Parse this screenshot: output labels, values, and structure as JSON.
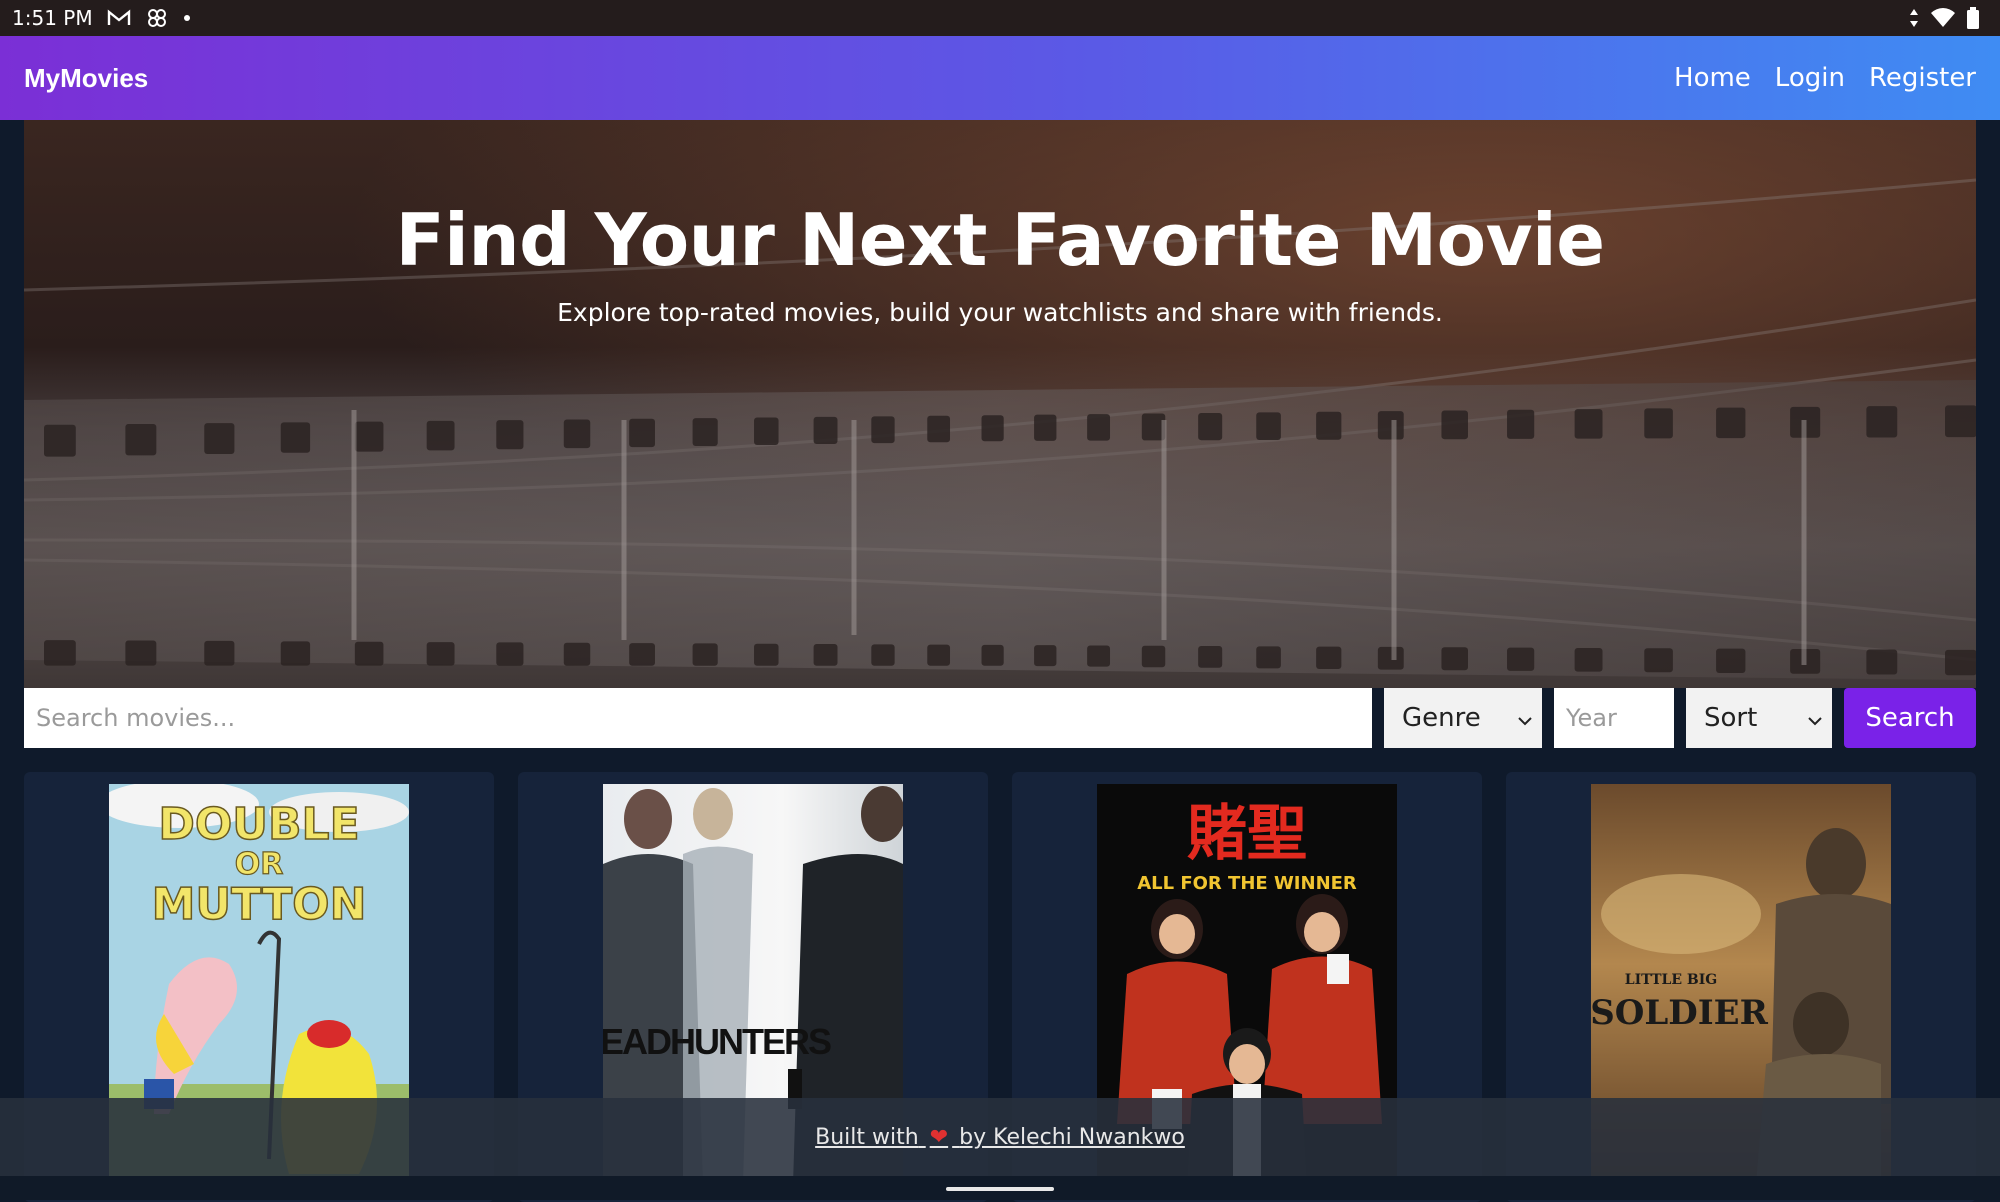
{
  "statusbar": {
    "time": "1:51 PM",
    "icons": [
      "gmail-icon",
      "pinwheel-icon",
      "dot-icon"
    ],
    "right_icons": [
      "data-icon",
      "wifi-icon",
      "battery-icon"
    ]
  },
  "navbar": {
    "brand": "MyMovies",
    "links": [
      "Home",
      "Login",
      "Register"
    ]
  },
  "hero": {
    "title": "Find Your Next Favorite Movie",
    "subtitle": "Explore top-rated movies, build your watchlists and share with friends."
  },
  "search": {
    "placeholder": "Search movies...",
    "genre": "Genre",
    "year_placeholder": "Year",
    "sort": "Sort",
    "button": "Search"
  },
  "movies": [
    {
      "title_art": [
        "DOUBLE",
        "OR",
        "MUTTON"
      ]
    },
    {
      "title_art": [
        "HEADHUNTERS"
      ]
    },
    {
      "title_art": [
        "賭聖",
        "ALL FOR THE WINNER"
      ]
    },
    {
      "title_art": [
        "LITTLE BIG",
        "SOLDIER"
      ]
    }
  ],
  "footer": {
    "pre": "Built with",
    "post": "by Kelechi Nwankwo"
  },
  "colors": {
    "accent": "#7a22e8",
    "nav_start": "#7b2fd6",
    "nav_end": "#3f8cf3",
    "background": "#0f1a2b"
  }
}
